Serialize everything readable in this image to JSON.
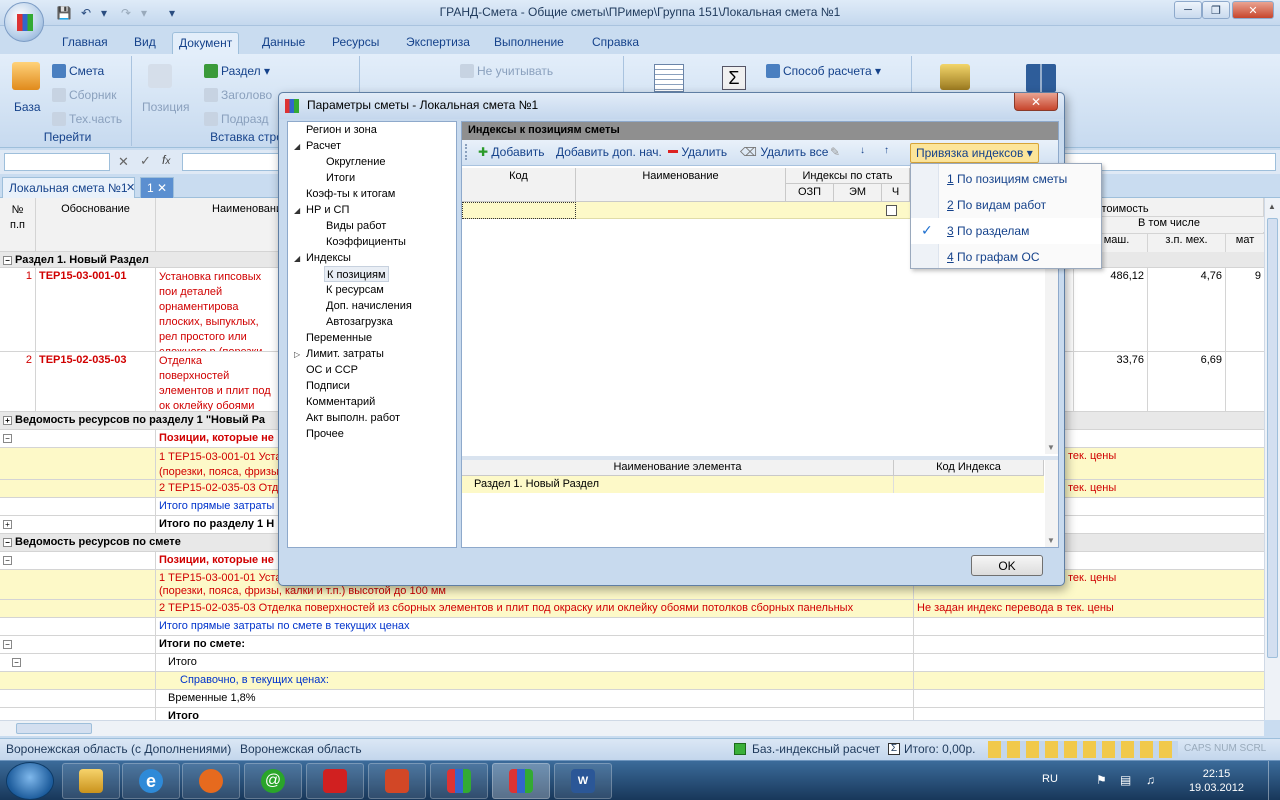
{
  "window": {
    "title": "ГРАНД-Смета - Общие сметы\\ПРимер\\Группа 151\\Локальная смета №1"
  },
  "ribbon_tabs": [
    "Главная",
    "Вид",
    "Документ",
    "Данные",
    "Ресурсы",
    "Экспертиза",
    "Выполнение",
    "Справка"
  ],
  "ribbon": {
    "nav_group": {
      "label": "Перейти",
      "base": "База",
      "smeta": "Смета",
      "sbornik": "Сборник",
      "techpart": "Тех.часть"
    },
    "insert_group": {
      "label": "Вставка стро",
      "position": "Позиция",
      "section": "Раздел",
      "heading": "Заголово",
      "subsection": "Подразд"
    },
    "exclude": "Не учитывать",
    "calc_method": "Способ расчета"
  },
  "doc_tabs": {
    "first": "Локальная смета №1",
    "second": "1"
  },
  "grid": {
    "headers": {
      "num": "№ п.п",
      "basis": "Обоснование",
      "name": "Наименовани",
      "cost": "стоимость",
      "incl": "В том числе",
      "zp_mash": "п. маш.",
      "zp_meh": "з.п. мех.",
      "mat": "мат"
    },
    "section1": "Раздел 1. Новый Раздел",
    "row1": {
      "num": "1",
      "code": "ТЕР15-03-001-01",
      "text": "Установка гипсовых пои деталей орнаментирова плоских, выпуклых, рел простого или сложного р (порезки, пояса, фризы т.п.) высотой до 100 мм",
      "v1": "486,12",
      "v2": "4,76",
      "v3": "9"
    },
    "row2": {
      "num": "2",
      "code": "ТЕР15-02-035-03",
      "text": "Отделка поверхностей элементов и плит под ок оклейку обоями потолков панельных",
      "v1": "33,76",
      "v2": "6,69"
    },
    "res_section": "Ведомость ресурсов по разделу 1 \"Новый Ра",
    "no_index_pos": "Позиции, которые не",
    "pos1_short": "1 ТЕР15-03-001-01 Уста",
    "pos1_short2": "(порезки, пояса, фризы",
    "pos2_short": "2 ТЕР15-02-035-03 Отде",
    "direct_short": "Итого прямые затраты",
    "total_section": "Итого по разделу 1 Н",
    "note_short": "тек. цены",
    "res_smeta": "Ведомость ресурсов по смете",
    "pos1_full": "1 ТЕР15-03-001-01 Устан",
    "pos1_full2": "(порезки, пояса, фризы, калки и т.п.) высотой до 100 мм",
    "pos2_full": "2 ТЕР15-02-035-03 Отделка поверхностей из сборных элементов и плит под окраску или оклейку обоями потолков сборных панельных",
    "no_index_note": "Не задан индекс перевода в тек. цены",
    "direct_full": "Итого прямые затраты по смете в текущих ценах",
    "totals": "Итоги по смете:",
    "itogo": "Итого",
    "reference": "Справочно, в текущих ценах:",
    "temporary": "Временные 1,8%",
    "itogo2": "Итого"
  },
  "status": {
    "region1": "Воронежская область (с Дополнениями)",
    "region2": "Воронежская область",
    "calc": "Баз.-индексный расчет",
    "total": "Итого: 0,00р.",
    "keys": "CAPS  NUM  SCRL"
  },
  "taskbar": {
    "lang": "RU",
    "time": "22:15",
    "date": "19.03.2012"
  },
  "dialog": {
    "title": "Параметры сметы - Локальная смета №1",
    "tree": [
      "Регион и зона",
      "Расчет",
      "Округление",
      "Итоги",
      "Коэф-ты к итогам",
      "НР и СП",
      "Виды работ",
      "Коэффициенты",
      "Индексы",
      "К позициям",
      "К ресурсам",
      "Доп. начисления",
      "Автозагрузка",
      "Переменные",
      "Лимит. затраты",
      "ОС и ССР",
      "Подписи",
      "Комментарий",
      "Акт выполн. работ",
      "Прочее"
    ],
    "panel_title": "Индексы к позициям сметы",
    "toolbar": {
      "add": "Добавить",
      "add_extra": "Добавить доп. нач.",
      "delete": "Удалить",
      "delete_all": "Удалить все",
      "binding": "Привязка индексов"
    },
    "table": {
      "code": "Код",
      "name": "Наименование",
      "indices": "Индексы по стать",
      "ozp": "ОЗП",
      "em": "ЭМ",
      "ch": "Ч"
    },
    "lower": {
      "elem": "Наименование элемента",
      "code": "Код Индекса",
      "row": "Раздел 1. Новый Раздел"
    },
    "ok": "OK"
  },
  "dropdown": {
    "items": [
      {
        "key": "1",
        "label": "По позициям сметы",
        "checked": false
      },
      {
        "key": "2",
        "label": "По видам работ",
        "checked": false
      },
      {
        "key": "3",
        "label": "По разделам",
        "checked": true
      },
      {
        "key": "4",
        "label": "По графам ОС",
        "checked": false
      }
    ]
  },
  "colors": {
    "accent": "#15428b",
    "error_text": "#d00000",
    "info_text": "#0033cc",
    "highlight": "#fdf9c8"
  }
}
